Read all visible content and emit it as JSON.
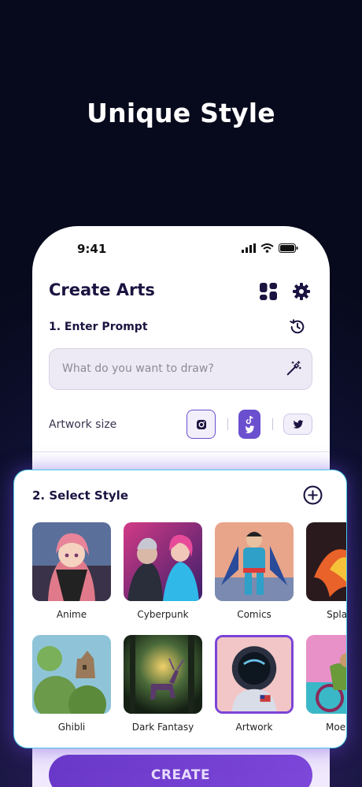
{
  "headline": "Unique Style",
  "status": {
    "time": "9:41"
  },
  "app": {
    "title": "Create Arts",
    "section1": "1. Enter Prompt",
    "prompt_placeholder": "What do you want to draw?",
    "artwork_size_label": "Artwork size",
    "section2": "2. Select Style",
    "create_label": "CREATE"
  },
  "styles": [
    {
      "name": "Anime",
      "selected": false
    },
    {
      "name": "Cyberpunk",
      "selected": false
    },
    {
      "name": "Comics",
      "selected": false
    },
    {
      "name": "Splatter",
      "selected": false
    },
    {
      "name": "Ghibli",
      "selected": false
    },
    {
      "name": "Dark Fantasy",
      "selected": false
    },
    {
      "name": "Artwork",
      "selected": true
    },
    {
      "name": "Moebius",
      "selected": false
    }
  ],
  "colors": {
    "accent": "#6a4fcf",
    "card_border": "#45c8e8",
    "title": "#1b1340"
  }
}
